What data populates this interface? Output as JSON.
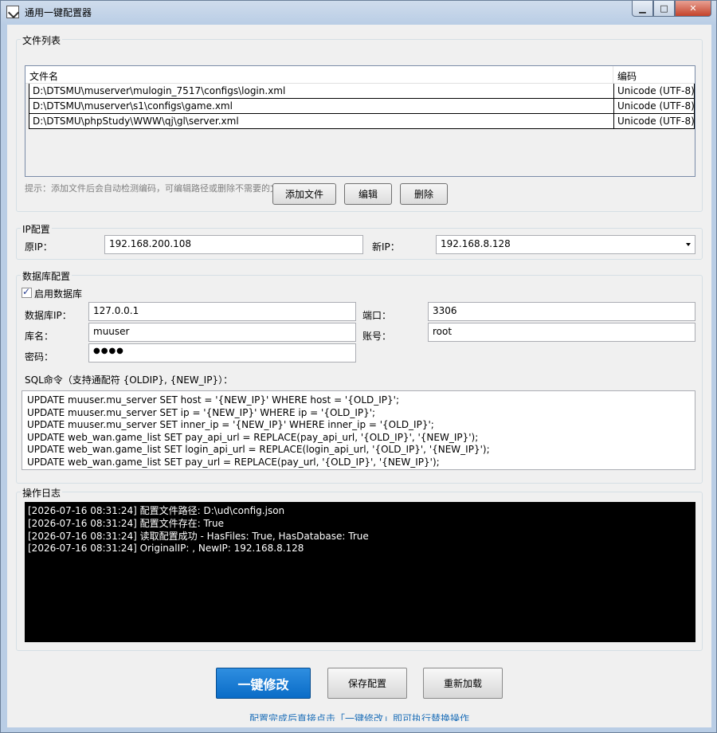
{
  "window": {
    "title": "通用一键配置器",
    "controls": {
      "minimize": "▁",
      "maximize": "□",
      "close": "✕"
    }
  },
  "files": {
    "group_title": "文件列表",
    "columns": [
      "文件名",
      "编码"
    ],
    "rows": [
      [
        "D:\\DTSMU\\muserver\\mulogin_7517\\configs\\login.xml",
        "Unicode (UTF-8)"
      ],
      [
        "D:\\DTSMU\\muserver\\s1\\configs\\game.xml",
        "Unicode (UTF-8)"
      ],
      [
        "D:\\DTSMU\\phpStudy\\WWW\\qj\\gl\\server.xml",
        "Unicode (UTF-8)"
      ]
    ],
    "hint": "提示：添加文件后会自动检测编码，可编辑路径或删除不需要的文件",
    "buttons": {
      "add": "添加文件",
      "edit": "编辑",
      "delete": "删除"
    }
  },
  "ip": {
    "group_title": "IP配置",
    "original_label": "原IP：",
    "original_value": "192.168.200.108",
    "new_label": "新IP：",
    "new_value": "192.168.8.128"
  },
  "database": {
    "group_title": "数据库配置",
    "enable_label": "启用数据库",
    "enabled": true,
    "db_ip_label": "数据库IP：",
    "db_ip_value": "127.0.0.1",
    "port_label": "端口：",
    "port_value": "3306",
    "db_name_label": "库名：",
    "db_name_value": "muuser",
    "account_label": "账号：",
    "account_value": "root",
    "password_label": "密码：",
    "password_value": "●●●●",
    "sql_label": "SQL命令（支持通配符 {OLDIP}, {NEW_IP}）：",
    "sql_lines": [
      "UPDATE muuser.mu_server SET host = '{NEW_IP}' WHERE host = '{OLD_IP}';",
      "UPDATE muuser.mu_server SET ip = '{NEW_IP}' WHERE ip = '{OLD_IP}';",
      "UPDATE muuser.mu_server SET inner_ip = '{NEW_IP}' WHERE inner_ip = '{OLD_IP}';",
      "UPDATE web_wan.game_list SET pay_api_url = REPLACE(pay_api_url, '{OLD_IP}', '{NEW_IP}');",
      "UPDATE web_wan.game_list SET login_api_url = REPLACE(login_api_url, '{OLD_IP}', '{NEW_IP}');",
      "UPDATE web_wan.game_list SET pay_url = REPLACE(pay_url, '{OLD_IP}', '{NEW_IP}');"
    ]
  },
  "log": {
    "group_title": "操作日志",
    "lines": [
      "[2026-07-16 08:31:24] 配置文件路径: D:\\ud\\config.json",
      "[2026-07-16 08:31:24] 配置文件存在: True",
      "[2026-07-16 08:31:24] 读取配置成功 - HasFiles: True, HasDatabase: True",
      "[2026-07-16 08:31:24] OriginalIP: , NewIP: 192.168.8.128"
    ]
  },
  "actions": {
    "apply": "一键修改",
    "save": "保存配置",
    "reload": "重新加载",
    "footer_hint": "配置完成后直接点击「一键修改」即可执行替换操作"
  },
  "colors": {
    "primary": "#0a6cc7",
    "log_background": "#000000",
    "footer_hint": "#1e6fb8"
  }
}
